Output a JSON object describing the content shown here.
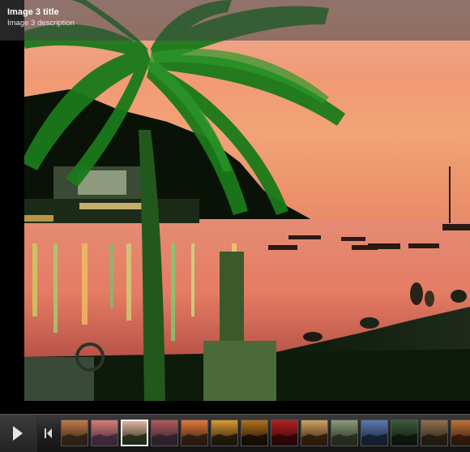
{
  "slide": {
    "title": "Image 3 title",
    "description": "Image 3 description"
  },
  "controls": {
    "play_icon": "play-icon",
    "prev_icon": "skip-previous-icon"
  },
  "thumbnails": {
    "count": 14,
    "active_index": 2,
    "themes": [
      [
        "#2a1e14",
        "#c07a48"
      ],
      [
        "#3a2638",
        "#d87c76"
      ],
      [
        "#1e2a14",
        "#e0b0a0"
      ],
      [
        "#2a1e2c",
        "#b05a5a"
      ],
      [
        "#281810",
        "#e0783c"
      ],
      [
        "#1a1408",
        "#d89a30"
      ],
      [
        "#120c04",
        "#b07020"
      ],
      [
        "#2a0606",
        "#b02020"
      ],
      [
        "#2a1808",
        "#d0a060"
      ],
      [
        "#24281c",
        "#8a9a7a"
      ],
      [
        "#141c2c",
        "#5a7ab0"
      ],
      [
        "#0a140a",
        "#3a5a3a"
      ],
      [
        "#1e1a12",
        "#907050"
      ],
      [
        "#2a160a",
        "#c0703a"
      ]
    ]
  }
}
